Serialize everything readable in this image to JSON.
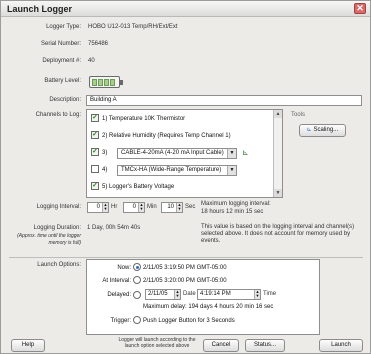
{
  "window": {
    "title": "Launch Logger",
    "close_label": "✕"
  },
  "info": {
    "logger_type_label": "Logger Type:",
    "logger_type": "HOBO U12-013 Temp/RH/Ext/Ext",
    "serial_label": "Serial Number:",
    "serial": "756486",
    "deployment_label": "Deployment #:",
    "deployment": "40",
    "battery_label": "Battery Level:",
    "battery_level": 0.8,
    "description_label": "Description:",
    "description": "Building A"
  },
  "channels": {
    "label": "Channels to Log:",
    "items": [
      {
        "num": "1)",
        "label": "Temperature 10K Thermistor",
        "checked": true
      },
      {
        "num": "2)",
        "label": "Relative Humidity (Requires Temp Channel 1)",
        "checked": true
      },
      {
        "num": "3)",
        "label": "CABLE-4-20mA (4-20 mA Input Cable)",
        "checked": true,
        "dropdown": true
      },
      {
        "num": "4)",
        "label": "TMCx-HA (Wide-Range Temperature)",
        "checked": false,
        "dropdown": true
      },
      {
        "num": "5)",
        "label": "Logger's Battery Voltage",
        "checked": true
      }
    ],
    "tools_label": "Tools",
    "scaling_button": "Scaling..."
  },
  "interval": {
    "label": "Logging Interval:",
    "hr_value": "0",
    "hr_unit": "Hr",
    "min_value": "0",
    "min_unit": "Min",
    "sec_value": "10",
    "sec_unit": "Sec",
    "max_text": "Maximum logging interval:",
    "max_value": "18 hours 12 min 15 sec"
  },
  "duration": {
    "label": "Logging Duration:",
    "sub_label": "(Approx. time until the logger memory is full)",
    "value": "1 Day, 00h 54m 40s",
    "note": "This value is based on the logging interval and channel(s) selected above. It does not account for memory used by events."
  },
  "launch": {
    "label": "Launch Options:",
    "now_label": "Now:",
    "now_value": "2/11/05 3:19:50 PM GMT-05:00",
    "interval_label": "At Interval:",
    "interval_value": "2/11/05 3:20:00 PM GMT-05:00",
    "delayed_label": "Delayed:",
    "delayed_date": "2/11/05",
    "date_label": "Date",
    "delayed_time": "4:19:14 PM",
    "time_label": "Time",
    "max_delay": "Maximum delay: 194 days 4 hours 20 min 16 sec",
    "trigger_label": "Trigger:",
    "trigger_value": "Push Logger Button for 3 Seconds"
  },
  "footer": {
    "help": "Help",
    "note": "Logger will launch according to the launch option selected above",
    "cancel": "Cancel",
    "status": "Status...",
    "launch": "Launch"
  }
}
